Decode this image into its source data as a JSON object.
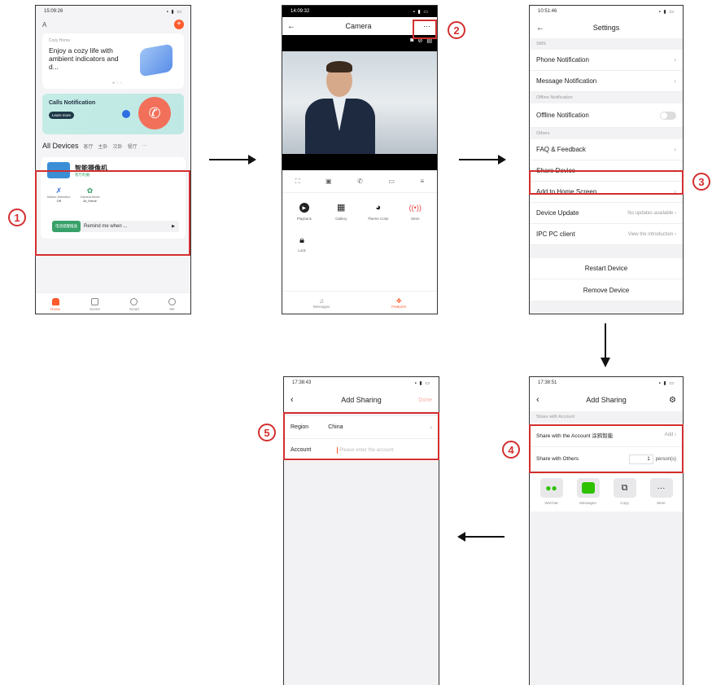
{
  "steps": {
    "s1": "1",
    "s2": "2",
    "s3": "3",
    "s4": "4",
    "s5": "5"
  },
  "home": {
    "time": "15:09:26",
    "home_selector": "A",
    "banner_tag": "Cozy Home",
    "banner_text": "Enjoy a cozy life with ambient indicators and d...",
    "calls_title": "Calls Notification",
    "calls_btn": "Learn more",
    "tabs": [
      "All Devices",
      "客厅",
      "主卧",
      "次卧",
      "餐厅",
      "···"
    ],
    "device_name": "智能摄像机",
    "device_sub": "客厅的摄",
    "feat1_label": "Motion Detection",
    "feat1_value": "Off",
    "feat2_label": "Camera Mode",
    "feat2_value": "At_Home",
    "remind_tag": "电话提醒推送",
    "remind_text": "Remind me when ...",
    "nav": [
      "Home",
      "Scene",
      "Smart",
      "Me"
    ],
    "colors": {
      "accent": "#ff5a2b",
      "teal": "#bfe8e4"
    }
  },
  "camera": {
    "time": "14:09:32",
    "title": "Camera",
    "more": "···",
    "features": [
      {
        "label": "Playback",
        "icon": "play-icon"
      },
      {
        "label": "Gallery",
        "icon": "gallery-icon"
      },
      {
        "label": "Theme Color",
        "icon": "palette-icon"
      },
      {
        "label": "Siren",
        "icon": "siren-icon"
      }
    ],
    "lock_label": "Lock",
    "nav": [
      "Messages",
      "Features"
    ]
  },
  "settings": {
    "time": "10:51:46",
    "title": "Settings",
    "sec1": "SMS",
    "phone_notification": "Phone Notification",
    "message_notification": "Message Notification",
    "sec2": "Offline Notification",
    "offline_notification": "Offline Notification",
    "sec3": "Others",
    "faq": "FAQ & Feedback",
    "share_device": "Share Device",
    "add_home": "Add to Home Screen",
    "device_update": "Device Update",
    "device_update_val": "No updates available",
    "ipc": "IPC PC client",
    "ipc_val": "View the introduction",
    "restart": "Restart Device",
    "remove": "Remove Device"
  },
  "share": {
    "time": "17:38:51",
    "title": "Add Sharing",
    "section": "Share with Account",
    "account_row": "Share with the Account 涂鸦智能",
    "add": "Add",
    "others_row": "Share with Others",
    "count": "1",
    "unit": "person(s)",
    "apps": [
      {
        "label": "WeChat",
        "icon": "wechat-icon"
      },
      {
        "label": "Messages",
        "icon": "messages-icon"
      },
      {
        "label": "Copy",
        "icon": "copy-icon"
      },
      {
        "label": "More",
        "icon": "more-icon"
      }
    ]
  },
  "account": {
    "time": "17:38:43",
    "title": "Add Sharing",
    "done": "Done",
    "region_label": "Region",
    "region_value": "China",
    "account_label": "Account",
    "account_placeholder": "Please enter the account"
  }
}
